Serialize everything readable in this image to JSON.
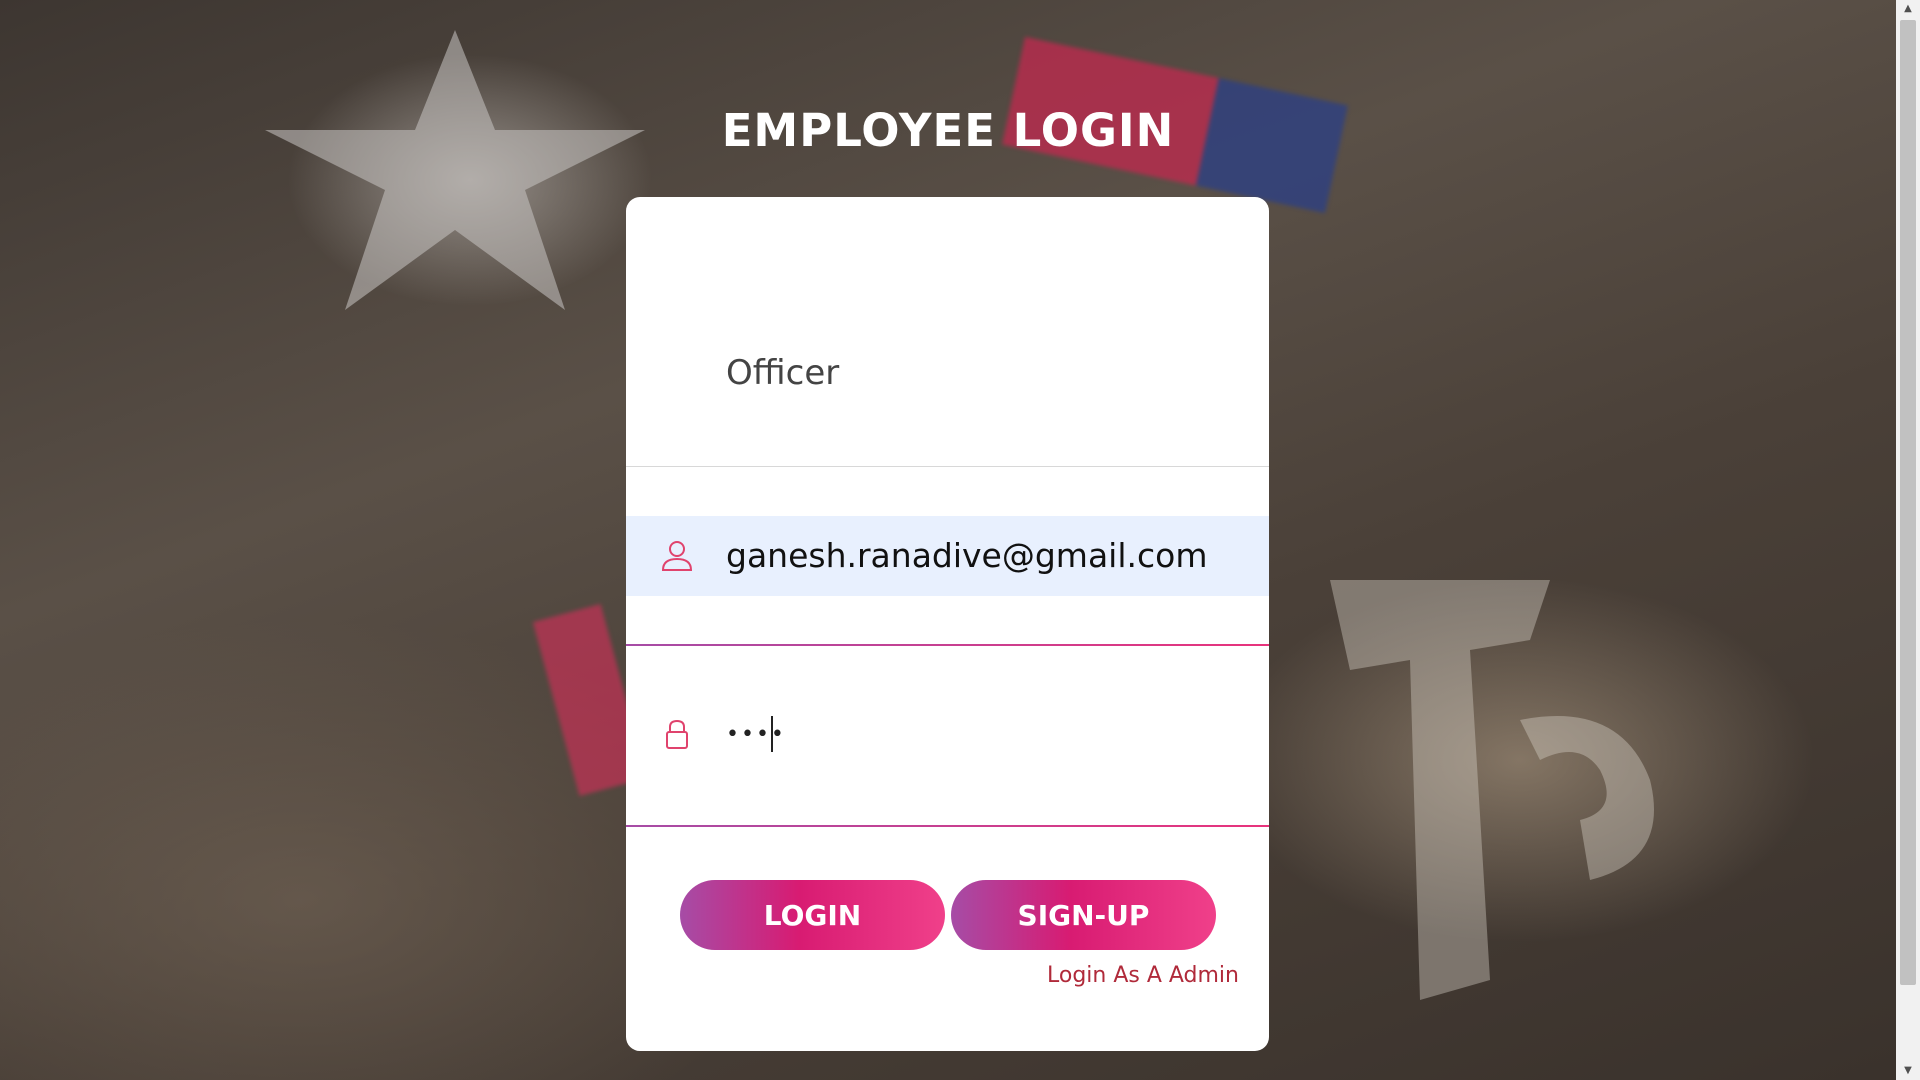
{
  "page": {
    "title": "EMPLOYEE LOGIN"
  },
  "form": {
    "role_value": "Officer",
    "email_value": "ganesh.ranadive@gmail.com",
    "password_masked": "••••",
    "login_label": "LOGIN",
    "signup_label": "SIGN-UP",
    "admin_link_label": "Login As A Admin"
  },
  "icons": {
    "user": "user-icon",
    "lock": "lock-icon"
  },
  "colors": {
    "accent_start": "#a64ca6",
    "accent_end": "#f0408a",
    "icon_color": "#e0436d",
    "link_color": "#b02a3a",
    "autofill_bg": "#e8f0fe"
  }
}
